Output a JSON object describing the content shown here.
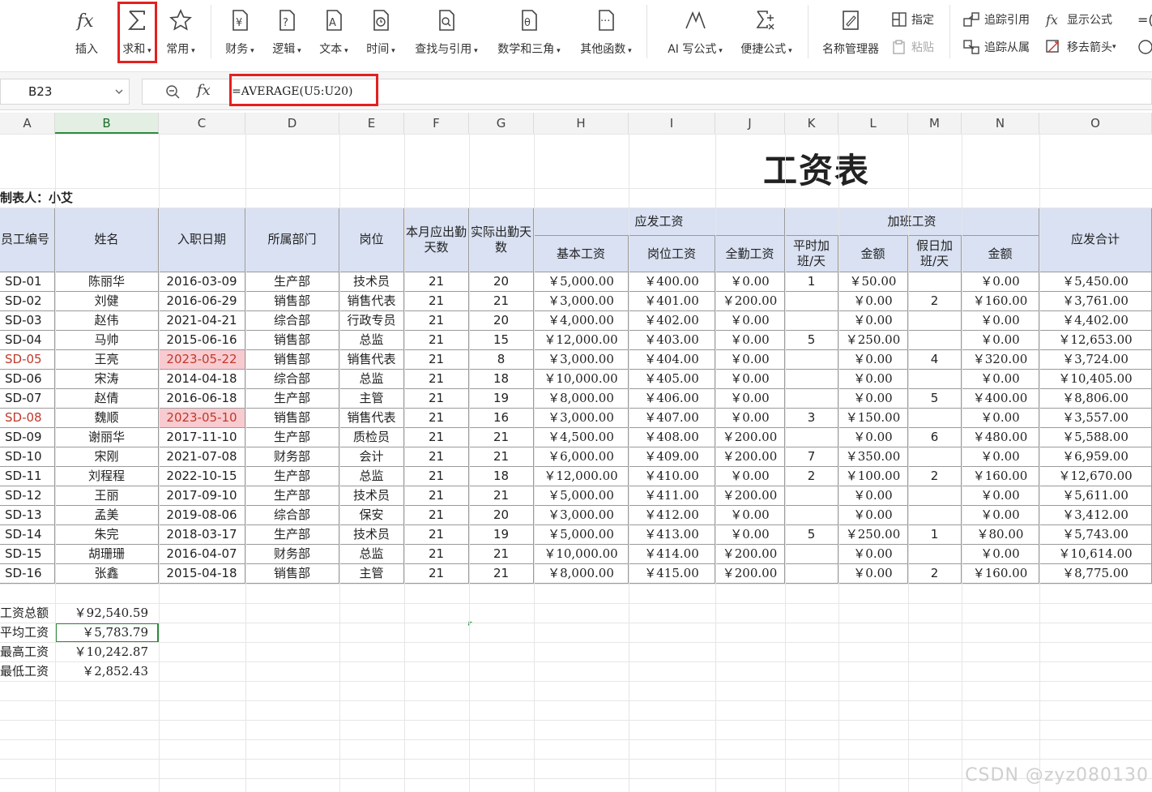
{
  "ribbon": {
    "buttons": [
      {
        "label": "插入",
        "icon": "fx-icon"
      },
      {
        "label": "求和",
        "icon": "sigma-icon"
      },
      {
        "label": "常用",
        "icon": "star-icon"
      },
      {
        "label": "财务",
        "icon": "finance-icon"
      },
      {
        "label": "逻辑",
        "icon": "logic-icon"
      },
      {
        "label": "文本",
        "icon": "text-icon"
      },
      {
        "label": "时间",
        "icon": "clock-icon"
      },
      {
        "label": "查找与引用",
        "icon": "lookup-icon"
      },
      {
        "label": "数学和三角",
        "icon": "math-icon"
      },
      {
        "label": "其他函数",
        "icon": "more-functions-icon"
      },
      {
        "label": "AI 写公式",
        "icon": "ai-formula-icon"
      },
      {
        "label": "便捷公式",
        "icon": "quick-formula-icon"
      },
      {
        "label": "名称管理器",
        "icon": "name-manager-icon"
      }
    ],
    "small": {
      "assign": "指定",
      "paste": "粘贴",
      "trace_precedents": "追踪引用",
      "show_formula": "显示公式",
      "trace_dependents": "追踪从属",
      "remove_arrows": "移去箭头"
    }
  },
  "formula_bar": {
    "cell_ref": "B23",
    "fx": "fx",
    "formula": "=AVERAGE(U5:U20)"
  },
  "columns": [
    "A",
    "B",
    "C",
    "D",
    "E",
    "F",
    "G",
    "H",
    "I",
    "J",
    "K",
    "L",
    "M",
    "N",
    "O"
  ],
  "sheet": {
    "title": "工资表",
    "maker": "制表人：小艾",
    "headers": {
      "emp_id": "员工编号",
      "name": "姓名",
      "hire_date": "入职日期",
      "dept": "所属部门",
      "post": "岗位",
      "due_days": "本月应出勤天数",
      "actual_days": "实际出勤天数",
      "payable": "应发工资",
      "base": "基本工资",
      "post_pay": "岗位工资",
      "attendance": "全勤工资",
      "overtime": "加班工资",
      "weekday_ot": "平时加班/天",
      "amount": "金额",
      "holiday_ot": "假日加班/天",
      "amount2": "金额",
      "total": "应发合计"
    },
    "rows": [
      [
        "SD-01",
        "陈丽华",
        "2016-03-09",
        "生产部",
        "技术员",
        "21",
        "20",
        "￥5,000.00",
        "￥400.00",
        "￥0.00",
        "1",
        "￥50.00",
        "",
        "￥0.00",
        "￥5,450.00"
      ],
      [
        "SD-02",
        "刘健",
        "2016-06-29",
        "销售部",
        "销售代表",
        "21",
        "21",
        "￥3,000.00",
        "￥401.00",
        "￥200.00",
        "",
        "￥0.00",
        "2",
        "￥160.00",
        "￥3,761.00"
      ],
      [
        "SD-03",
        "赵伟",
        "2021-04-21",
        "综合部",
        "行政专员",
        "21",
        "20",
        "￥4,000.00",
        "￥402.00",
        "￥0.00",
        "",
        "￥0.00",
        "",
        "￥0.00",
        "￥4,402.00"
      ],
      [
        "SD-04",
        "马帅",
        "2015-06-16",
        "销售部",
        "总监",
        "21",
        "15",
        "￥12,000.00",
        "￥403.00",
        "￥0.00",
        "5",
        "￥250.00",
        "",
        "￥0.00",
        "￥12,653.00"
      ],
      [
        "SD-05",
        "王亮",
        "2023-05-22",
        "销售部",
        "销售代表",
        "21",
        "8",
        "￥3,000.00",
        "￥404.00",
        "￥0.00",
        "",
        "￥0.00",
        "4",
        "￥320.00",
        "￥3,724.00"
      ],
      [
        "SD-06",
        "宋涛",
        "2014-04-18",
        "综合部",
        "总监",
        "21",
        "18",
        "￥10,000.00",
        "￥405.00",
        "￥0.00",
        "",
        "￥0.00",
        "",
        "￥0.00",
        "￥10,405.00"
      ],
      [
        "SD-07",
        "赵倩",
        "2016-06-18",
        "生产部",
        "主管",
        "21",
        "19",
        "￥8,000.00",
        "￥406.00",
        "￥0.00",
        "",
        "￥0.00",
        "5",
        "￥400.00",
        "￥8,806.00"
      ],
      [
        "SD-08",
        "魏顺",
        "2023-05-10",
        "销售部",
        "销售代表",
        "21",
        "16",
        "￥3,000.00",
        "￥407.00",
        "￥0.00",
        "3",
        "￥150.00",
        "",
        "￥0.00",
        "￥3,557.00"
      ],
      [
        "SD-09",
        "谢丽华",
        "2017-11-10",
        "生产部",
        "质检员",
        "21",
        "21",
        "￥4,500.00",
        "￥408.00",
        "￥200.00",
        "",
        "￥0.00",
        "6",
        "￥480.00",
        "￥5,588.00"
      ],
      [
        "SD-10",
        "宋刚",
        "2021-07-08",
        "财务部",
        "会计",
        "21",
        "21",
        "￥6,000.00",
        "￥409.00",
        "￥200.00",
        "7",
        "￥350.00",
        "",
        "￥0.00",
        "￥6,959.00"
      ],
      [
        "SD-11",
        "刘程程",
        "2022-10-15",
        "生产部",
        "总监",
        "21",
        "18",
        "￥12,000.00",
        "￥410.00",
        "￥0.00",
        "2",
        "￥100.00",
        "2",
        "￥160.00",
        "￥12,670.00"
      ],
      [
        "SD-12",
        "王丽",
        "2017-09-10",
        "生产部",
        "技术员",
        "21",
        "21",
        "￥5,000.00",
        "￥411.00",
        "￥200.00",
        "",
        "￥0.00",
        "",
        "￥0.00",
        "￥5,611.00"
      ],
      [
        "SD-13",
        "孟美",
        "2019-08-06",
        "综合部",
        "保安",
        "21",
        "20",
        "￥3,000.00",
        "￥412.00",
        "￥0.00",
        "",
        "￥0.00",
        "",
        "￥0.00",
        "￥3,412.00"
      ],
      [
        "SD-14",
        "朱完",
        "2018-03-17",
        "生产部",
        "技术员",
        "21",
        "19",
        "￥5,000.00",
        "￥413.00",
        "￥0.00",
        "5",
        "￥250.00",
        "1",
        "￥80.00",
        "￥5,743.00"
      ],
      [
        "SD-15",
        "胡珊珊",
        "2016-04-07",
        "财务部",
        "总监",
        "21",
        "21",
        "￥10,000.00",
        "￥414.00",
        "￥200.00",
        "",
        "￥0.00",
        "",
        "￥0.00",
        "￥10,614.00"
      ],
      [
        "SD-16",
        "张鑫",
        "2015-04-18",
        "销售部",
        "主管",
        "21",
        "21",
        "￥8,000.00",
        "￥415.00",
        "￥200.00",
        "",
        "￥0.00",
        "2",
        "￥160.00",
        "￥8,775.00"
      ]
    ],
    "summary": [
      {
        "label": "工资总额",
        "value": "￥92,540.59"
      },
      {
        "label": "平均工资",
        "value": "￥5,783.79"
      },
      {
        "label": "最高工资",
        "value": "￥10,242.87"
      },
      {
        "label": "最低工资",
        "value": "￥2,852.43"
      }
    ]
  },
  "watermark": "CSDN @zyz080130"
}
